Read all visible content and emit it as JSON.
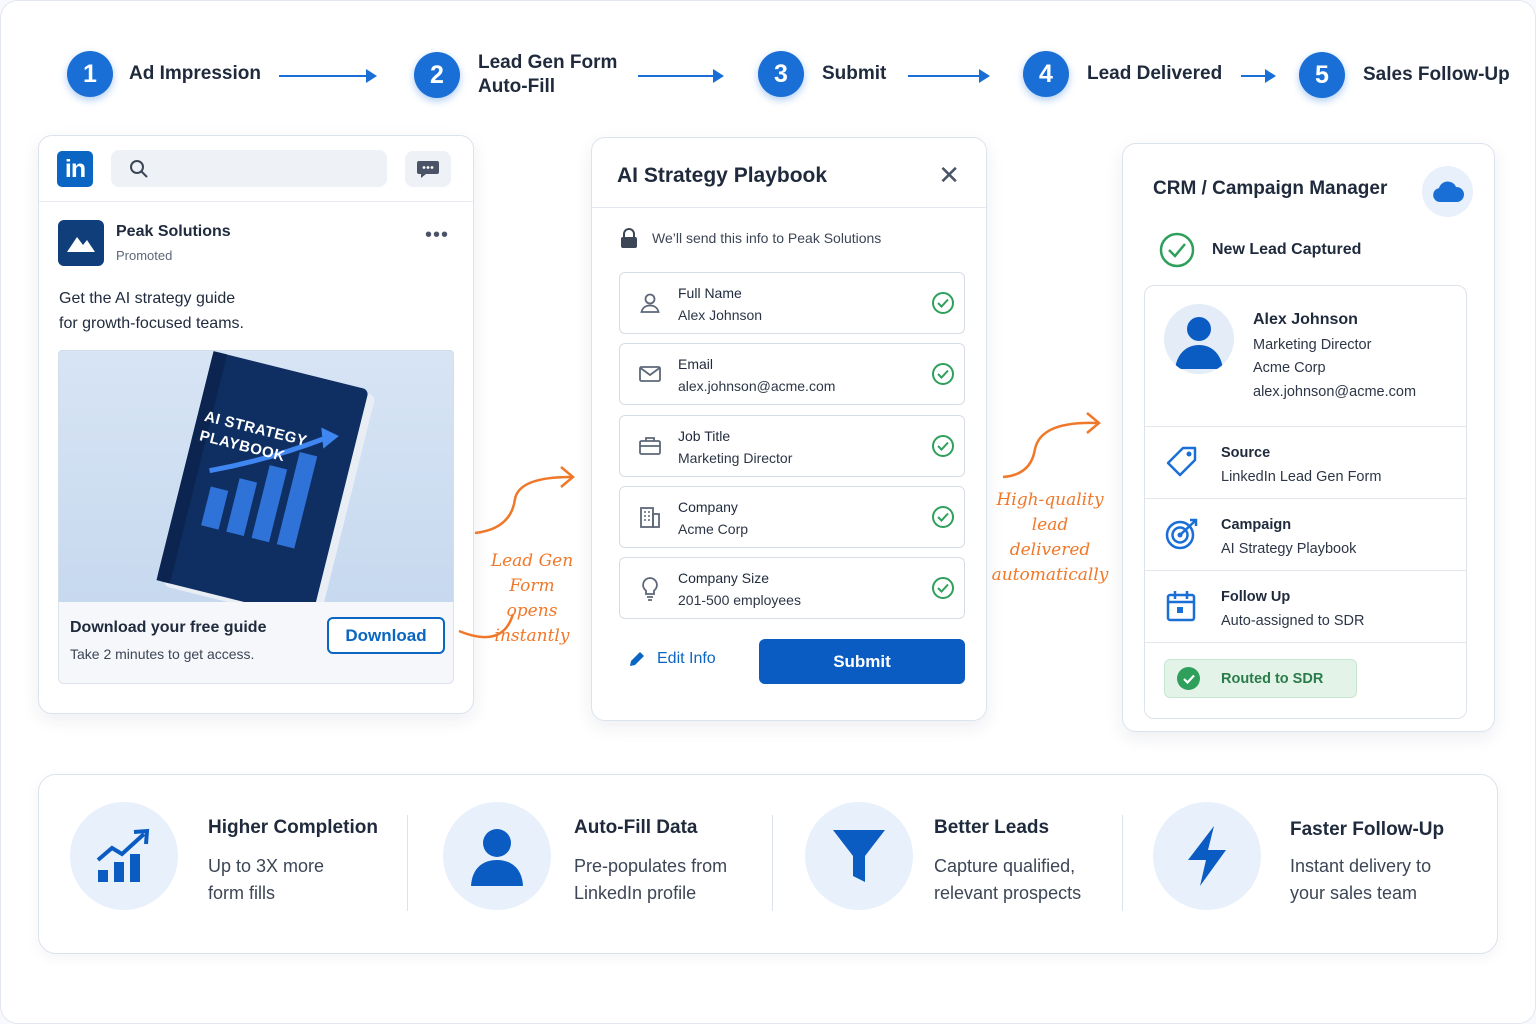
{
  "steps": [
    {
      "num": "1",
      "label": "Ad Impression"
    },
    {
      "num": "2",
      "label": "Lead Gen Form\nAuto-Fill"
    },
    {
      "num": "3",
      "label": "Submit"
    },
    {
      "num": "4",
      "label": "Lead Delivered"
    },
    {
      "num": "5",
      "label": "Sales Follow-Up"
    }
  ],
  "linkedin": {
    "logo_text": "in",
    "company": "Peak Solutions",
    "promoted": "Promoted",
    "post_text": "Get the AI strategy guide\nfor growth-focused teams.",
    "book_title": "AI STRATEGY\nPLAYBOOK",
    "cta_title": "Download your free guide",
    "cta_sub": "Take 2 minutes to get access.",
    "download_label": "Download",
    "menu_icon": "more-icon"
  },
  "form": {
    "title": "AI Strategy Playbook",
    "close_label": "✕",
    "privacy_note": "We’ll send this info to Peak Solutions",
    "fields": [
      {
        "label": "Full Name",
        "value": "Alex Johnson",
        "icon": "user-icon"
      },
      {
        "label": "Email",
        "value": "alex.johnson@acme.com",
        "icon": "mail-icon"
      },
      {
        "label": "Job Title",
        "value": "Marketing Director",
        "icon": "briefcase-icon"
      },
      {
        "label": "Company",
        "value": "Acme Corp",
        "icon": "building-icon"
      },
      {
        "label": "Company Size",
        "value": "201-500 employees",
        "icon": "lightbulb-icon"
      }
    ],
    "edit_label": "Edit Info",
    "submit_label": "Submit"
  },
  "crm": {
    "title": "CRM / Campaign Manager",
    "status": "New Lead Captured",
    "lead": {
      "name": "Alex Johnson",
      "title": "Marketing Director",
      "company": "Acme Corp",
      "email": "alex.johnson@acme.com"
    },
    "rows": [
      {
        "label": "Source",
        "value": "LinkedIn Lead Gen Form",
        "icon": "tag-icon"
      },
      {
        "label": "Campaign",
        "value": "AI Strategy Playbook",
        "icon": "target-icon"
      },
      {
        "label": "Follow Up",
        "value": "Auto-assigned to SDR",
        "icon": "calendar-icon"
      }
    ],
    "routed_label": "Routed to SDR"
  },
  "annotations": {
    "form_opens": "Lead Gen Form\nopens instantly",
    "lead_delivered": "High-quality\nlead delivered\nautomatically"
  },
  "benefits": [
    {
      "title": "Higher Completion",
      "desc": "Up to 3X more\nform fills",
      "icon": "chart-up-icon"
    },
    {
      "title": "Auto-Fill Data",
      "desc": "Pre-populates from\nLinkedIn profile",
      "icon": "user-icon"
    },
    {
      "title": "Better Leads",
      "desc": "Capture qualified,\nrelevant prospects",
      "icon": "funnel-icon"
    },
    {
      "title": "Faster Follow-Up",
      "desc": "Instant delivery to\nyour sales team",
      "icon": "lightning-icon"
    }
  ],
  "colors": {
    "accent": "#1a6fd6",
    "linkedin_blue": "#0a66c2",
    "annotation_orange": "#f0782a",
    "success_green": "#2ea05b"
  }
}
